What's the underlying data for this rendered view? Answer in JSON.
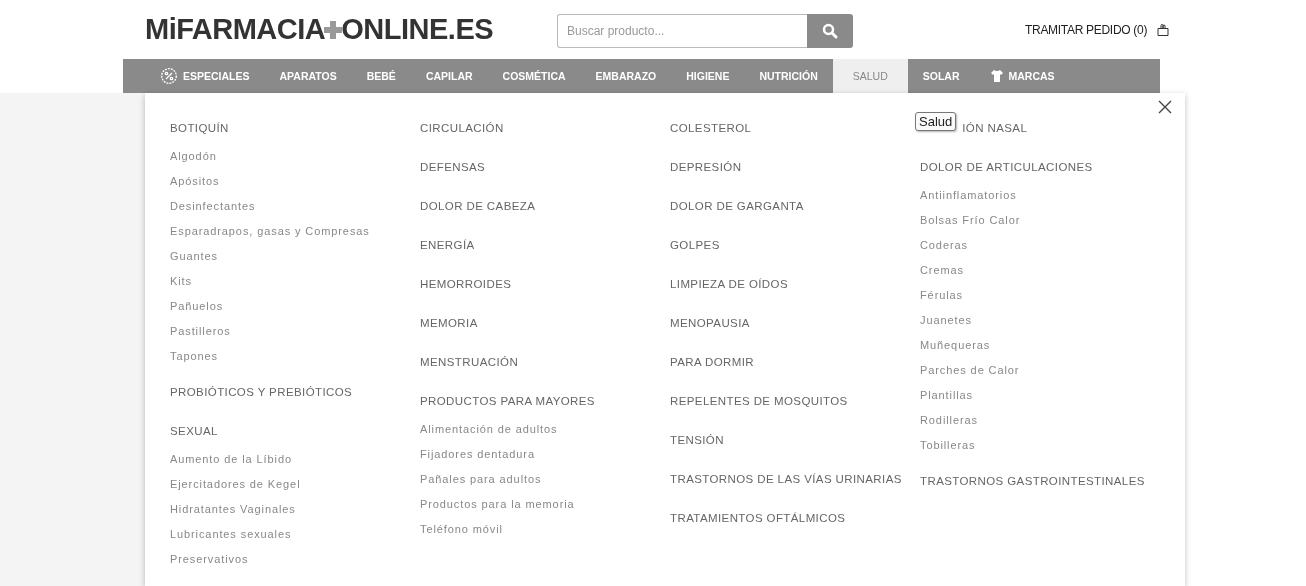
{
  "header": {
    "logo": {
      "left": "MiFARMACIA",
      "right": "ONLINE.ES"
    },
    "search": {
      "placeholder": "Buscar producto..."
    },
    "cart": "TRAMITAR PEDIDO (0)"
  },
  "nav": [
    {
      "label": "ESPECIALES",
      "kind": "percent",
      "selected": false
    },
    {
      "label": "APARATOS",
      "selected": false
    },
    {
      "label": "BEBÉ",
      "selected": false
    },
    {
      "label": "CAPILAR",
      "selected": false
    },
    {
      "label": "COSMÉTICA",
      "selected": false
    },
    {
      "label": "EMBARAZO",
      "selected": false
    },
    {
      "label": "HIGIENE",
      "selected": false
    },
    {
      "label": "NUTRICIÓN",
      "selected": false
    },
    {
      "label": "SALUD",
      "selected": true
    },
    {
      "label": "SOLAR",
      "selected": false
    },
    {
      "label": "MARCAS",
      "kind": "brand",
      "selected": false
    }
  ],
  "menu": {
    "columns": [
      {
        "groups": [
          {
            "title": "BOTIQUÍN",
            "items": [
              "Algodón",
              "Apósitos",
              "Desinfectantes",
              "Esparadrapos, gasas y Compresas",
              "Guantes",
              "Kits",
              "Pañuelos",
              "Pastilleros",
              "Tapones"
            ]
          },
          {
            "title": "PROBIÓTICOS Y PREBIÓTICOS"
          },
          {
            "title": "SEXUAL",
            "items": [
              "Aumento de la Líbido",
              "Ejercitadores de Kegel",
              "Hidratantes Vaginales",
              "Lubricantes sexuales",
              "Preservativos"
            ]
          }
        ]
      },
      {
        "groups": [
          {
            "title": "CIRCULACIÓN"
          },
          {
            "title": "DEFENSAS"
          },
          {
            "title": "DOLOR DE CABEZA"
          },
          {
            "title": "ENERGÍA"
          },
          {
            "title": "HEMORROIDES"
          },
          {
            "title": "MEMORIA"
          },
          {
            "title": "MENSTRUACIÓN"
          },
          {
            "title": "PRODUCTOS PARA MAYORES",
            "items": [
              "Alimentación de adultos",
              "Fijadores dentadura",
              "Pañales para adultos",
              "Productos para la memoria",
              "Teléfono móvil"
            ]
          }
        ]
      },
      {
        "groups": [
          {
            "title": "COLESTEROL"
          },
          {
            "title": "DEPRESIÓN"
          },
          {
            "title": "DOLOR DE GARGANTA"
          },
          {
            "title": "GOLPES"
          },
          {
            "title": "LIMPIEZA DE OÍDOS"
          },
          {
            "title": "MENOPAUSIA"
          },
          {
            "title": "PARA DORMIR"
          },
          {
            "title": "REPELENTES DE MOSQUITOS"
          },
          {
            "title": "TENSIÓN"
          },
          {
            "title": "TRASTORNOS DE LAS VÍAS URINARIAS"
          },
          {
            "title": "TRATAMIENTOS OFTÁLMICOS"
          }
        ]
      },
      {
        "tooltip": "Salud",
        "groups": [
          {
            "title": "IÓN NASAL"
          },
          {
            "title": "DOLOR DE ARTICULACIONES",
            "items": [
              "Antiinflamatorios",
              "Bolsas Frío Calor",
              "Coderas",
              "Cremas",
              "Férulas",
              "Juanetes",
              "Muñequeras",
              "Parches de Calor",
              "Plantillas",
              "Rodilleras",
              "Tobilleras"
            ]
          },
          {
            "title": "TRASTORNOS GASTROINTESTINALES"
          }
        ]
      }
    ]
  }
}
